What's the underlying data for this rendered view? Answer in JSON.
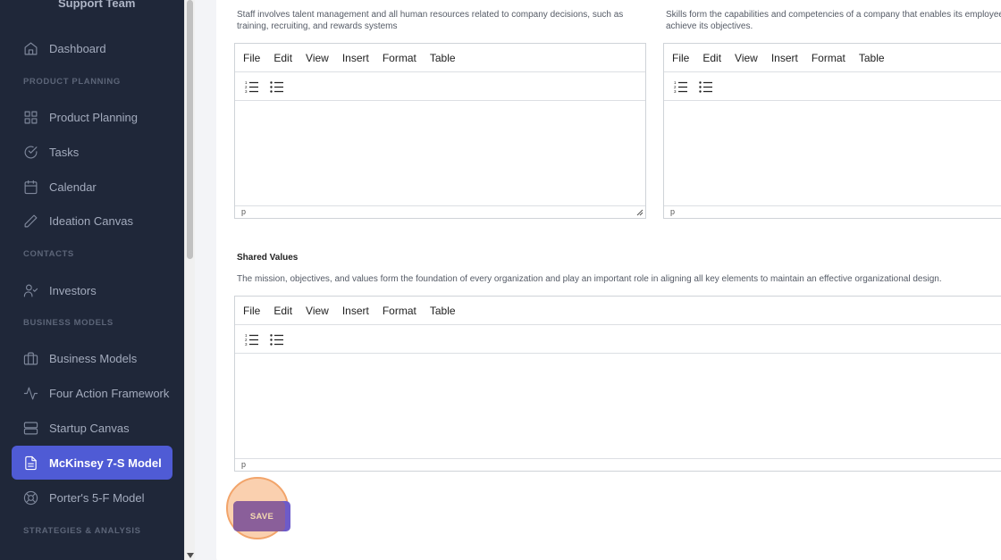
{
  "sidebar": {
    "team_name": "Support Team",
    "sections": {
      "product_planning": "PRODUCT PLANNING",
      "contacts": "CONTACTS",
      "business_models": "BUSINESS MODELS",
      "strategies": "STRATEGIES & ANALYSIS"
    },
    "items": [
      {
        "label": "Dashboard",
        "icon": "home-icon"
      },
      {
        "label": "Product Planning",
        "icon": "grid-icon"
      },
      {
        "label": "Tasks",
        "icon": "check-circle-icon"
      },
      {
        "label": "Calendar",
        "icon": "calendar-icon"
      },
      {
        "label": "Ideation Canvas",
        "icon": "pencil-icon"
      },
      {
        "label": "Investors",
        "icon": "user-check-icon"
      },
      {
        "label": "Business Models",
        "icon": "briefcase-icon"
      },
      {
        "label": "Four Action Framework",
        "icon": "activity-icon"
      },
      {
        "label": "Startup Canvas",
        "icon": "server-icon"
      },
      {
        "label": "McKinsey 7-S Model",
        "icon": "file-text-icon",
        "active": true
      },
      {
        "label": "Porter's 5-F Model",
        "icon": "life-buoy-icon"
      }
    ]
  },
  "fields": {
    "staff": {
      "description": "Staff involves talent management and all human resources related to company decisions, such as training, recruiting, and rewards systems"
    },
    "skills": {
      "description": "Skills form the capabilities and competencies of a company that enables its employees to achieve its objectives."
    },
    "shared_values": {
      "title": "Shared Values",
      "description": "The mission, objectives, and values form the foundation of every organization and play an important role in aligning all key elements to maintain an effective organizational design."
    }
  },
  "editor": {
    "menu": [
      "File",
      "Edit",
      "View",
      "Insert",
      "Format",
      "Table"
    ],
    "status_path": "p"
  },
  "actions": {
    "save_label": "SAVE"
  },
  "colors": {
    "sidebar_bg": "#1f2739",
    "active_item": "#4f5bd5",
    "save_button": "#6d5bc9",
    "click_highlight": "#f2a46a"
  }
}
